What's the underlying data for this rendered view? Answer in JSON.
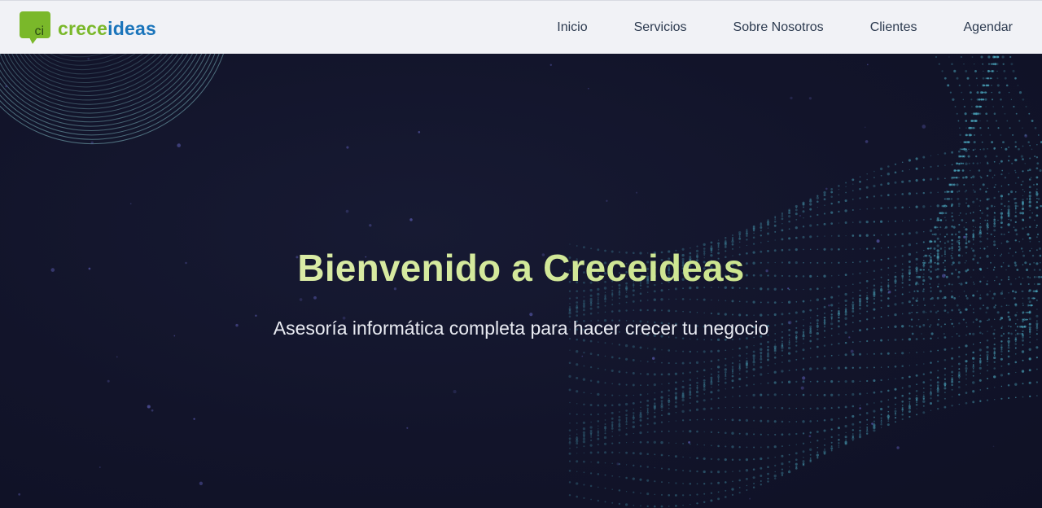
{
  "brand": {
    "logo_mark_text": "ci",
    "name_part1": "crece",
    "name_part2": "ideas",
    "colors": {
      "green": "#7ab82a",
      "blue": "#1b75bb"
    }
  },
  "nav": {
    "items": [
      {
        "label": "Inicio"
      },
      {
        "label": "Servicios"
      },
      {
        "label": "Sobre Nosotros"
      },
      {
        "label": "Clientes"
      },
      {
        "label": "Agendar"
      }
    ]
  },
  "hero": {
    "title": "Bienvenido a Creceideas",
    "subtitle": "Asesoría informática completa para hacer crecer tu negocio",
    "title_color": "#d6ea9f",
    "background_color": "#13152a"
  }
}
